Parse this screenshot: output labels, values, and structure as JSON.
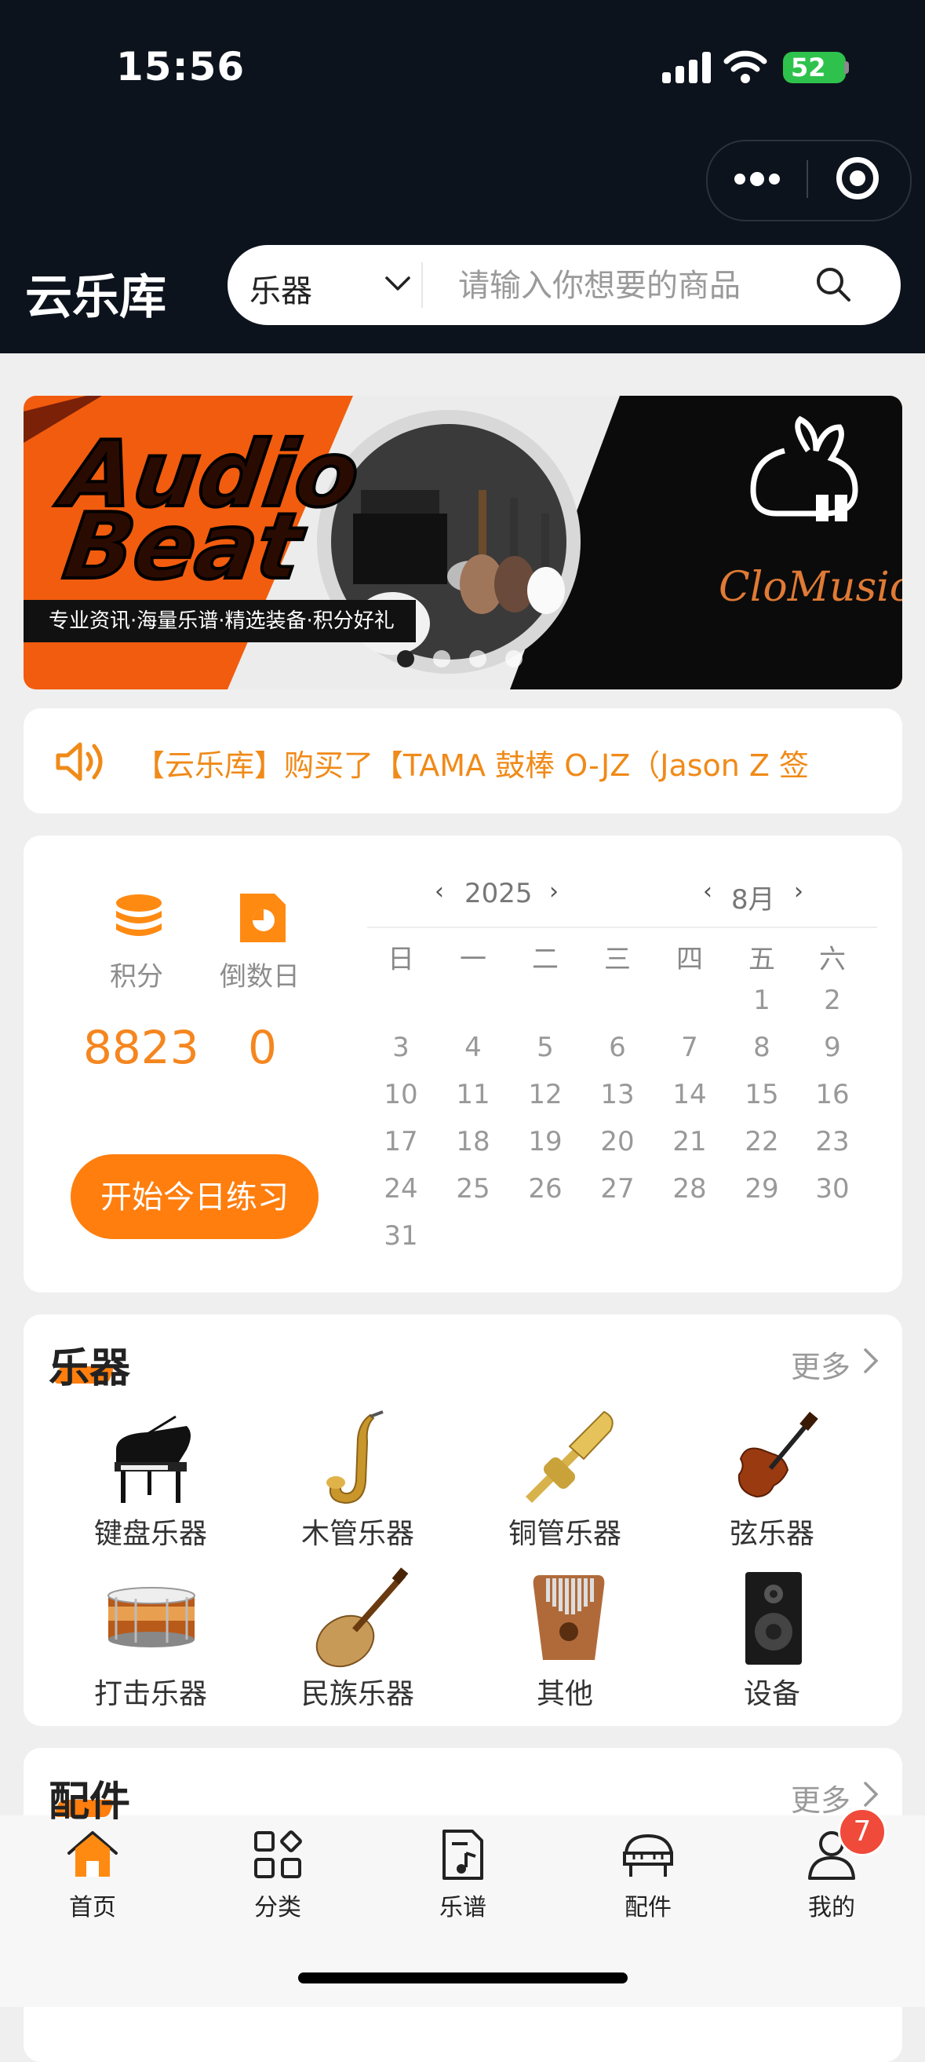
{
  "status_bar": {
    "time": "15:56",
    "battery": "52"
  },
  "header": {
    "title": "云乐库",
    "search": {
      "category": "乐器",
      "placeholder": "请输入你想要的商品"
    }
  },
  "banner": {
    "headline_line1": "Audio",
    "headline_line2": "Beat",
    "subtitle": "专业资讯·海量乐谱·精选装备·积分好礼",
    "brand": "CloMusic"
  },
  "notice": {
    "text": "【云乐库】购买了【TAMA 鼓棒 O-JZ（Jason Z 签"
  },
  "stats": {
    "points_label": "积分",
    "points_value": "8823",
    "countdown_label": "倒数日",
    "countdown_value": "0",
    "start_button": "开始今日练习"
  },
  "calendar": {
    "year": "2025",
    "month": "8月",
    "prev": "‹",
    "next": "›",
    "weekdays": [
      "日",
      "一",
      "二",
      "三",
      "四",
      "五",
      "六"
    ],
    "first_weekday_index": 5,
    "days": [
      "1",
      "2",
      "3",
      "4",
      "5",
      "6",
      "7",
      "8",
      "9",
      "10",
      "11",
      "12",
      "13",
      "14",
      "15",
      "16",
      "17",
      "18",
      "19",
      "20",
      "21",
      "22",
      "23",
      "24",
      "25",
      "26",
      "27",
      "28",
      "29",
      "30",
      "31"
    ]
  },
  "instruments": {
    "title": "乐器",
    "more": "更多",
    "items": [
      {
        "label": "键盘乐器",
        "icon": "piano-icon"
      },
      {
        "label": "木管乐器",
        "icon": "saxophone-icon"
      },
      {
        "label": "铜管乐器",
        "icon": "trumpet-icon"
      },
      {
        "label": "弦乐器",
        "icon": "violin-icon"
      },
      {
        "label": "打击乐器",
        "icon": "snare-drum-icon"
      },
      {
        "label": "民族乐器",
        "icon": "pipa-icon"
      },
      {
        "label": "其他",
        "icon": "kalimba-icon"
      },
      {
        "label": "设备",
        "icon": "speaker-icon"
      }
    ]
  },
  "accessories": {
    "title": "配件",
    "more": "更多"
  },
  "tabbar": {
    "tabs": [
      {
        "label": "首页",
        "icon": "home-icon",
        "active": true
      },
      {
        "label": "分类",
        "icon": "category-icon"
      },
      {
        "label": "乐谱",
        "icon": "sheet-music-icon"
      },
      {
        "label": "配件",
        "icon": "grand-piano-icon"
      },
      {
        "label": "我的",
        "icon": "profile-icon"
      }
    ],
    "badge": "7"
  },
  "colors": {
    "accent": "#ff7e0e",
    "header_bg": "#0d131d",
    "notice_text": "#f08a18"
  }
}
